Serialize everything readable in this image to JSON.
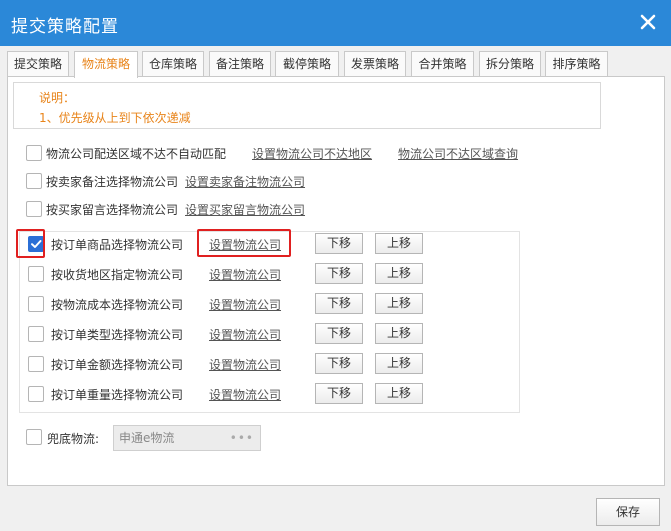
{
  "window": {
    "title": "提交策略配置"
  },
  "tabs": [
    {
      "label": "提交策略"
    },
    {
      "label": "物流策略",
      "active": true
    },
    {
      "label": "仓库策略"
    },
    {
      "label": "备注策略"
    },
    {
      "label": "截停策略"
    },
    {
      "label": "发票策略"
    },
    {
      "label": "合并策略"
    },
    {
      "label": "拆分策略"
    },
    {
      "label": "排序策略"
    }
  ],
  "note": {
    "heading": "说明：",
    "line1": "1、优先级从上到下依次递减"
  },
  "options": {
    "region_match": {
      "label": "物流公司配送区域不达不自动匹配",
      "link1": "设置物流公司不达地区",
      "link2": "物流公司不达区域查询",
      "checked": false
    },
    "seller_note": {
      "label": "按卖家备注选择物流公司",
      "link": "设置卖家备注物流公司",
      "checked": false
    },
    "buyer_msg": {
      "label": "按买家留言选择物流公司",
      "link": "设置买家留言物流公司",
      "checked": false
    }
  },
  "priority_rules": [
    {
      "label": "按订单商品选择物流公司",
      "link": "设置物流公司",
      "down": "下移",
      "up": "上移",
      "checked": true
    },
    {
      "label": "按收货地区指定物流公司",
      "link": "设置物流公司",
      "down": "下移",
      "up": "上移",
      "checked": false
    },
    {
      "label": "按物流成本选择物流公司",
      "link": "设置物流公司",
      "down": "下移",
      "up": "上移",
      "checked": false
    },
    {
      "label": "按订单类型选择物流公司",
      "link": "设置物流公司",
      "down": "下移",
      "up": "上移",
      "checked": false
    },
    {
      "label": "按订单金额选择物流公司",
      "link": "设置物流公司",
      "down": "下移",
      "up": "上移",
      "checked": false
    },
    {
      "label": "按订单重量选择物流公司",
      "link": "设置物流公司",
      "down": "下移",
      "up": "上移",
      "checked": false
    }
  ],
  "fallback": {
    "label": "兜底物流:",
    "value": "申通e物流",
    "dots": "•••",
    "checked": false
  },
  "footer": {
    "save_label": "保存"
  },
  "colors": {
    "titlebar": "#2b88d8",
    "accent": "#e8841a",
    "checkbox_checked": "#2b6fd6",
    "highlight": "#e02020"
  }
}
